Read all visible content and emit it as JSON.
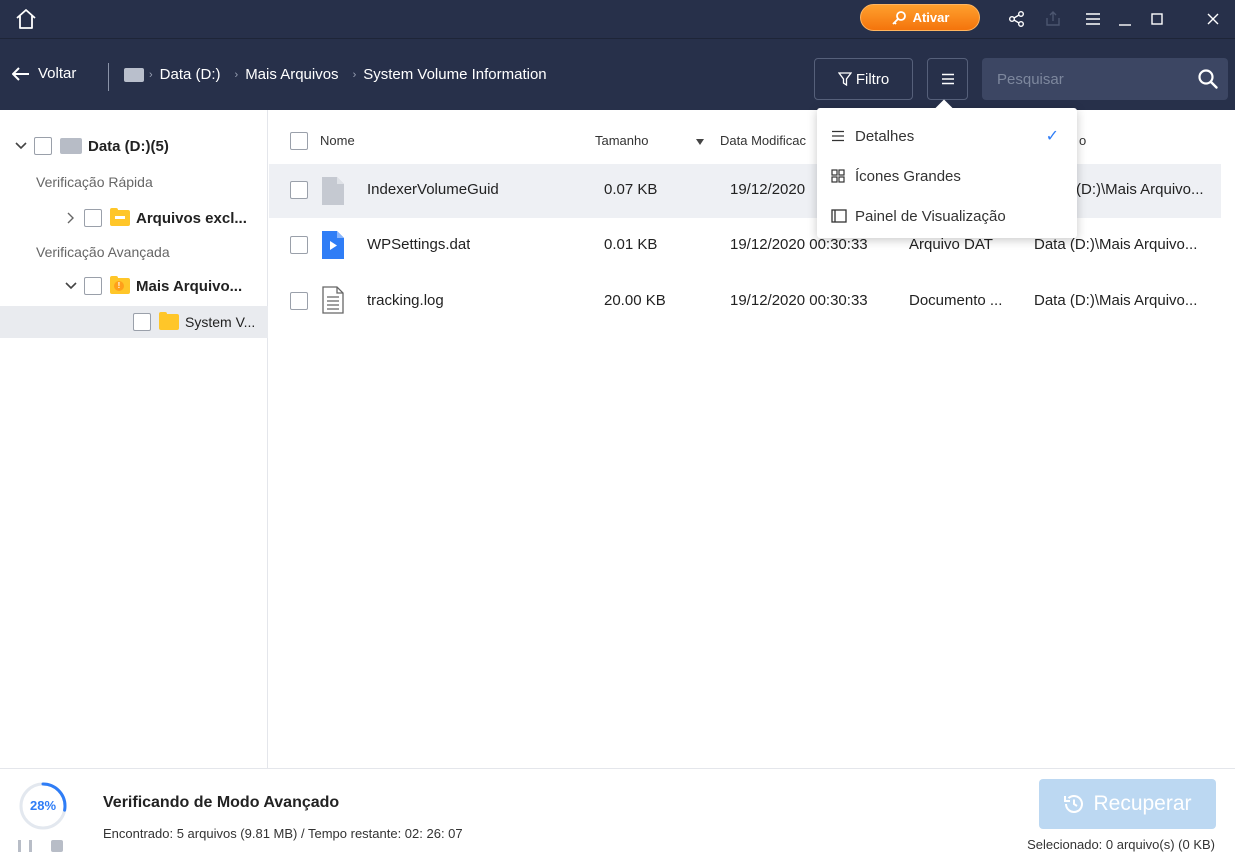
{
  "titlebar": {
    "activate_label": "Ativar",
    "accent": "#f4740c"
  },
  "toolbar": {
    "back_label": "Voltar",
    "breadcrumb": [
      "Data (D:)",
      "Mais Arquivos",
      "System Volume Information"
    ],
    "filter_label": "Filtro",
    "search_placeholder": "Pesquisar"
  },
  "tree": {
    "drive_label": "Data (D:)(5)",
    "quick_scan_label": "Verificação Rápida",
    "deleted_folder_label": "Arquivos excl...",
    "advanced_scan_label": "Verificação Avançada",
    "more_files_label": "Mais Arquivo...",
    "system_folder_label": "System V..."
  },
  "columns": {
    "name": "Nome",
    "size": "Tamanho",
    "date": "Data Modificac",
    "path_tail": "o"
  },
  "files": [
    {
      "name": "IndexerVolumeGuid",
      "size": "0.07 KB",
      "date": "19/12/2020",
      "type": "",
      "path": "(D:)\\Mais Arquivo..."
    },
    {
      "name": "WPSettings.dat",
      "size": "0.01 KB",
      "date": "19/12/2020 00:30:33",
      "type": "Arquivo DAT",
      "path": "Data (D:)\\Mais Arquivo..."
    },
    {
      "name": "tracking.log",
      "size": "20.00 KB",
      "date": "19/12/2020 00:30:33",
      "type": "Documento ...",
      "path": "Data (D:)\\Mais Arquivo..."
    }
  ],
  "view_menu": {
    "details": "Detalhes",
    "large_icons": "Ícones Grandes",
    "preview_pane": "Painel de Visualização",
    "check_mark": "✓"
  },
  "status": {
    "progress_percent": 28,
    "progress_label": "28%",
    "title": "Verificando de Modo Avançado",
    "detail": "Encontrado: 5 arquivos (9.81 MB) / Tempo restante: 02: 26: 07",
    "recover_label": "Recuperar",
    "selected_label": "Selecionado: 0 arquivo(s) (0 KB)"
  }
}
